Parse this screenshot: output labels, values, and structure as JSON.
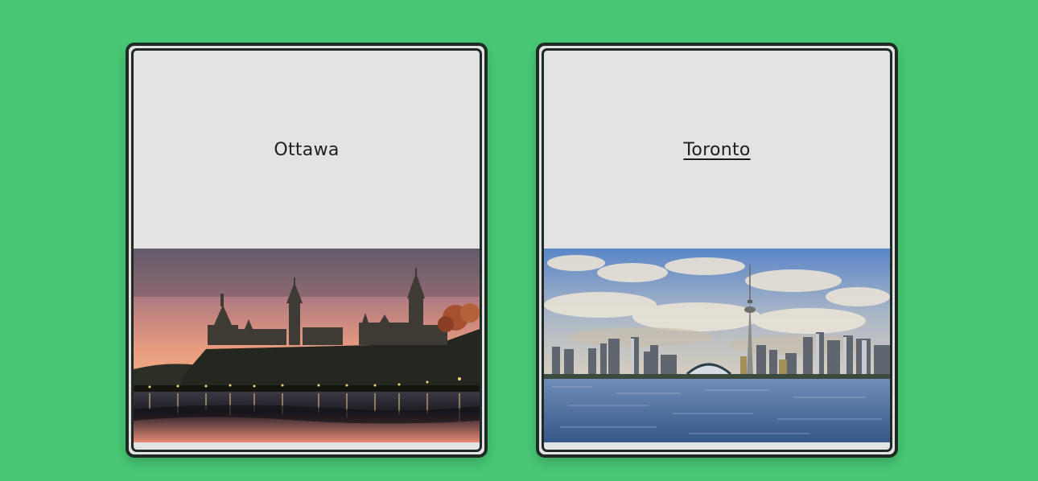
{
  "cards": [
    {
      "name": "Ottawa",
      "linked": false,
      "image": "parliament-hill-sunset-photo"
    },
    {
      "name": "Toronto",
      "linked": true,
      "image": "toronto-skyline-cn-tower-photo"
    }
  ],
  "colors": {
    "page_background": "#48c774",
    "card_background": "#e3e3e3",
    "card_border": "#1f2a24"
  }
}
